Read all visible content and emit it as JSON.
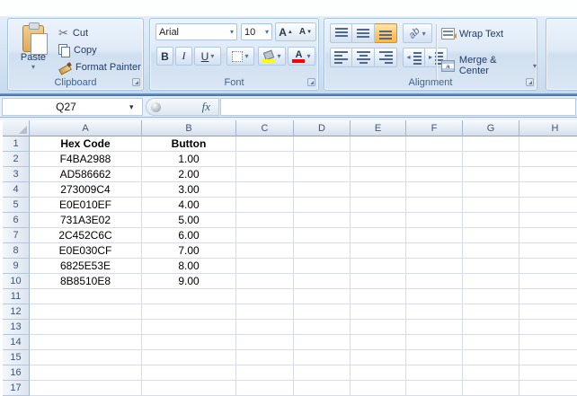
{
  "ribbon": {
    "clipboard": {
      "label": "Clipboard",
      "paste": "Paste",
      "cut": "Cut",
      "copy": "Copy",
      "format_painter": "Format Painter"
    },
    "font": {
      "label": "Font",
      "font_name": "Arial",
      "font_size": "10",
      "bold": "B",
      "italic": "I",
      "underline": "U",
      "grow": "A",
      "shrink": "A"
    },
    "alignment": {
      "label": "Alignment",
      "wrap_text": "Wrap Text",
      "merge_center": "Merge & Center",
      "orientation_glyph": "ab"
    }
  },
  "formula_bar": {
    "name_box": "Q27",
    "fx": "fx",
    "formula": ""
  },
  "grid": {
    "columns": [
      "A",
      "B",
      "C",
      "D",
      "E",
      "F",
      "G",
      "H"
    ],
    "rows": [
      "1",
      "2",
      "3",
      "4",
      "5",
      "6",
      "7",
      "8",
      "9",
      "10",
      "11",
      "12",
      "13",
      "14",
      "15",
      "16",
      "17"
    ],
    "table": {
      "headers": [
        "Hex Code",
        "Button"
      ],
      "rows": [
        [
          "F4BA2988",
          "1.00"
        ],
        [
          "AD586662",
          "2.00"
        ],
        [
          "273009C4",
          "3.00"
        ],
        [
          "E0E010EF",
          "4.00"
        ],
        [
          "731A3E02",
          "5.00"
        ],
        [
          "2C452C6C",
          "6.00"
        ],
        [
          "E0E030CF",
          "7.00"
        ],
        [
          "6825E53E",
          "8.00"
        ],
        [
          "8B8510E8",
          "9.00"
        ]
      ]
    }
  },
  "icons": {
    "dropdown": "▾",
    "scissors": "✂",
    "caret_up": "▲",
    "caret_down": "▼",
    "indent_left": "◂",
    "indent_right": "▸"
  },
  "colors": {
    "selected_button": "#ffc966",
    "ribbon_separator": "#43699f",
    "fill_color_bar": "#ffff00",
    "font_color_bar": "#ff0000"
  }
}
